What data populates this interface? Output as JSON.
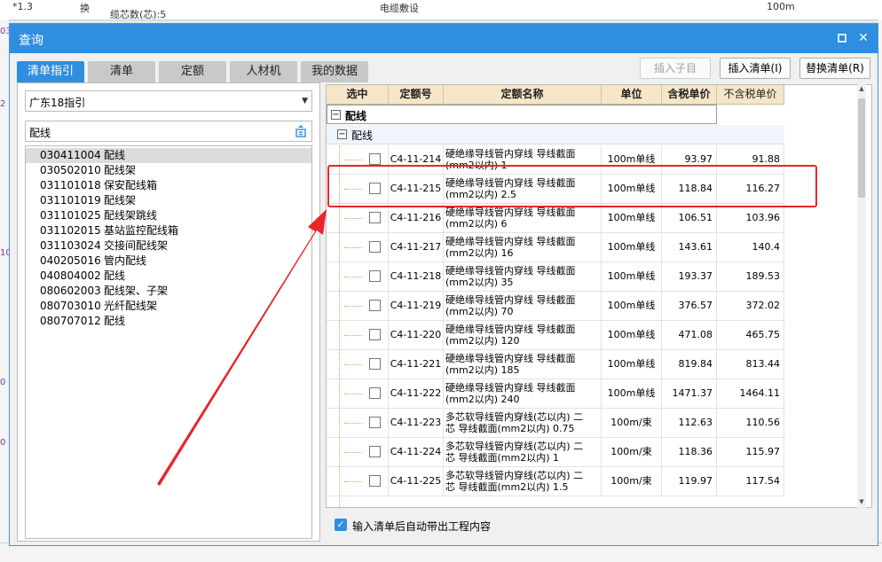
{
  "background": {
    "top_cells": [
      "*1.3",
      "换",
      "缆芯数(芯):5",
      "电缆敷设",
      "100m"
    ],
    "left_fragments": [
      "03",
      "2",
      "10",
      "0",
      "0"
    ]
  },
  "dialog": {
    "title": "查询",
    "tabs": [
      {
        "label": "清单指引",
        "active": true
      },
      {
        "label": "清单",
        "active": false
      },
      {
        "label": "定额",
        "active": false
      },
      {
        "label": "人材机",
        "active": false
      },
      {
        "label": "我的数据",
        "active": false
      }
    ],
    "buttons": {
      "insert_child": "插入子目",
      "insert_list": "插入清单(I)",
      "replace_list": "替换清单(R)"
    },
    "left": {
      "guide_select": "广东18指引",
      "search_value": "配线",
      "items": [
        {
          "code": "030411004",
          "name": "配线",
          "selected": true
        },
        {
          "code": "030502010",
          "name": "配线架",
          "selected": false
        },
        {
          "code": "031101018",
          "name": "保安配线箱",
          "selected": false
        },
        {
          "code": "031101019",
          "name": "配线架",
          "selected": false
        },
        {
          "code": "031101025",
          "name": "配线架跳线",
          "selected": false
        },
        {
          "code": "031102015",
          "name": "基站监控配线箱",
          "selected": false
        },
        {
          "code": "031103024",
          "name": "交接间配线架",
          "selected": false
        },
        {
          "code": "040205016",
          "name": "管内配线",
          "selected": false
        },
        {
          "code": "040804002",
          "name": "配线",
          "selected": false
        },
        {
          "code": "080602003",
          "name": "配线架、子架",
          "selected": false
        },
        {
          "code": "080703010",
          "name": "光纤配线架",
          "selected": false
        },
        {
          "code": "080707012",
          "name": "配线",
          "selected": false
        }
      ]
    },
    "grid": {
      "headers": [
        "选中",
        "定额号",
        "定额名称",
        "单位",
        "含税单价",
        "不含税单价"
      ],
      "group1": "配线",
      "group2": "配线",
      "rows": [
        {
          "code": "C4-11-214",
          "name1": "硬绝缘导线管内穿线 导线截面",
          "name2": "(mm2以内) 1",
          "unit": "100m单线",
          "price_tax": "93.97",
          "price_notax": "91.88"
        },
        {
          "code": "C4-11-215",
          "name1": "硬绝缘导线管内穿线 导线截面",
          "name2": "(mm2以内) 2.5",
          "unit": "100m单线",
          "price_tax": "118.84",
          "price_notax": "116.27"
        },
        {
          "code": "C4-11-216",
          "name1": "硬绝缘导线管内穿线 导线截面",
          "name2": "(mm2以内) 6",
          "unit": "100m单线",
          "price_tax": "106.51",
          "price_notax": "103.96"
        },
        {
          "code": "C4-11-217",
          "name1": "硬绝缘导线管内穿线 导线截面",
          "name2": "(mm2以内) 16",
          "unit": "100m单线",
          "price_tax": "143.61",
          "price_notax": "140.4"
        },
        {
          "code": "C4-11-218",
          "name1": "硬绝缘导线管内穿线 导线截面",
          "name2": "(mm2以内) 35",
          "unit": "100m单线",
          "price_tax": "193.37",
          "price_notax": "189.53"
        },
        {
          "code": "C4-11-219",
          "name1": "硬绝缘导线管内穿线 导线截面",
          "name2": "(mm2以内) 70",
          "unit": "100m单线",
          "price_tax": "376.57",
          "price_notax": "372.02"
        },
        {
          "code": "C4-11-220",
          "name1": "硬绝缘导线管内穿线 导线截面",
          "name2": "(mm2以内) 120",
          "unit": "100m单线",
          "price_tax": "471.08",
          "price_notax": "465.75"
        },
        {
          "code": "C4-11-221",
          "name1": "硬绝缘导线管内穿线 导线截面",
          "name2": "(mm2以内) 185",
          "unit": "100m单线",
          "price_tax": "819.84",
          "price_notax": "813.44"
        },
        {
          "code": "C4-11-222",
          "name1": "硬绝缘导线管内穿线 导线截面",
          "name2": "(mm2以内) 240",
          "unit": "100m单线",
          "price_tax": "1471.37",
          "price_notax": "1464.11"
        },
        {
          "code": "C4-11-223",
          "name1": "多芯软导线管内穿线(芯以内) 二",
          "name2": "芯 导线截面(mm2以内) 0.75",
          "unit": "100m/束",
          "price_tax": "112.63",
          "price_notax": "110.56"
        },
        {
          "code": "C4-11-224",
          "name1": "多芯软导线管内穿线(芯以内) 二",
          "name2": "芯 导线截面(mm2以内) 1",
          "unit": "100m/束",
          "price_tax": "118.36",
          "price_notax": "115.97"
        },
        {
          "code": "C4-11-225",
          "name1": "多芯软导线管内穿线(芯以内) 二",
          "name2": "芯 导线截面(mm2以内) 1.5",
          "unit": "100m/束",
          "price_tax": "119.97",
          "price_notax": "117.54"
        }
      ]
    },
    "footer": {
      "auto_checkbox_label": "输入清单后自动带出工程内容",
      "auto_checked": true
    }
  },
  "colors": {
    "accent": "#2f8ee0",
    "header_bg": "#f5e6c8",
    "annotation": "#e8262a"
  }
}
